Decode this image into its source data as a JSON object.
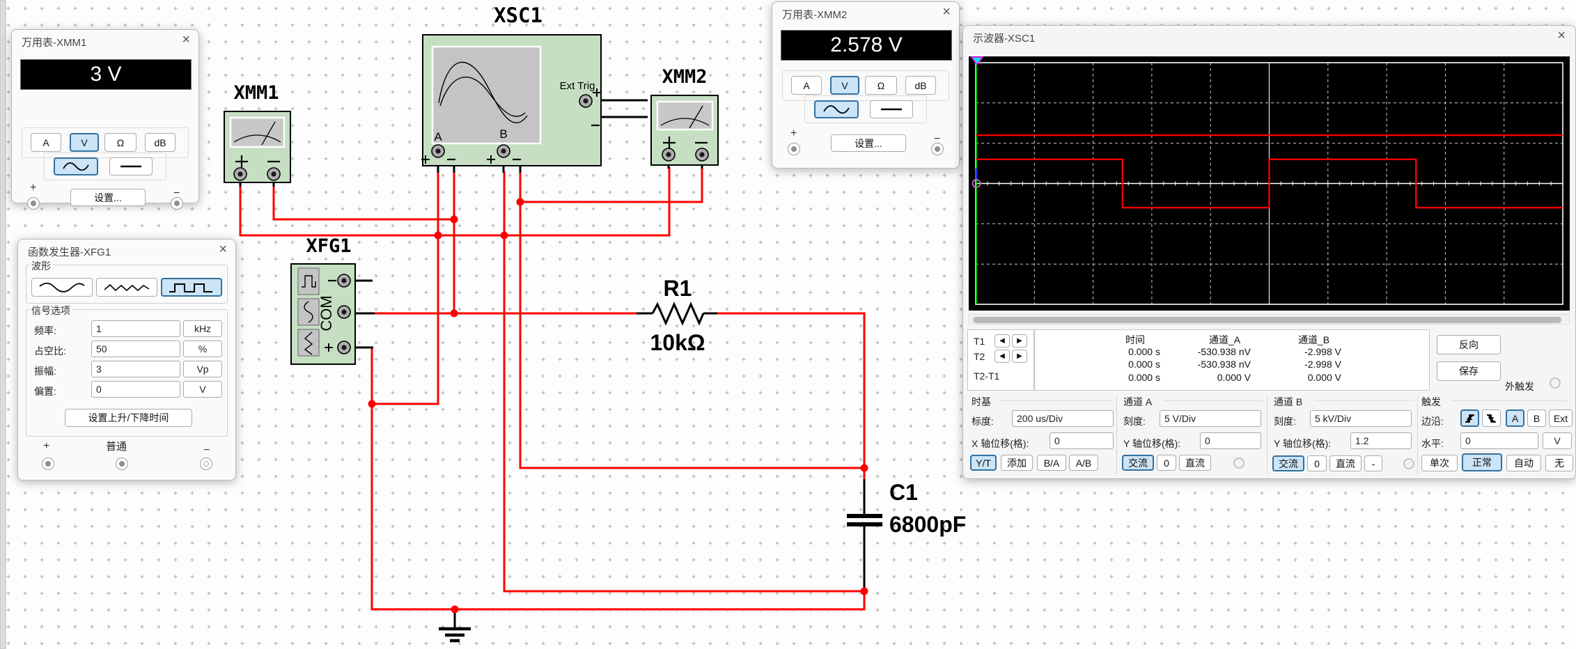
{
  "ui": {
    "close_icon": "×",
    "arrow_left_icon": "◀",
    "arrow_right_icon": "▶"
  },
  "xmm1": {
    "title": "万用表-XMM1",
    "display": "3 V",
    "modes": [
      "A",
      "V",
      "Ω",
      "dB"
    ],
    "selected_mode": "V",
    "ac_icon": "sine-wave",
    "dc_icon": "flat-line",
    "selected_coupling": "AC",
    "settings": "设置...",
    "plus": "+",
    "minus": "−"
  },
  "xmm2": {
    "title": "万用表-XMM2",
    "display": "2.578 V",
    "modes": [
      "A",
      "V",
      "Ω",
      "dB"
    ],
    "selected_mode": "V",
    "ac_icon": "sine-wave",
    "dc_icon": "flat-line",
    "selected_coupling": "AC",
    "settings": "设置...",
    "plus": "+",
    "minus": "−"
  },
  "xfg1": {
    "title": "函数发生器-XFG1",
    "waveform_group": "波形",
    "waveform_icons": [
      "sine-wave",
      "triangle-wave",
      "square-wave"
    ],
    "selected_waveform": "square-wave",
    "signal_group": "信号选项",
    "fields": [
      {
        "label": "频率:",
        "value": "1",
        "unit": "kHz"
      },
      {
        "label": "占空比:",
        "value": "50",
        "unit": "%"
      },
      {
        "label": "振幅:",
        "value": "3",
        "unit": "Vp"
      },
      {
        "label": "偏置:",
        "value": "0",
        "unit": "V"
      }
    ],
    "rise_fall_button": "设置上升/下降时间",
    "plus": "+",
    "common": "普通",
    "minus": "−"
  },
  "scope": {
    "title": "示波器-XSC1",
    "cursors": {
      "t1": "T1",
      "t2": "T2",
      "t2t1": "T2-T1"
    },
    "readout": {
      "headers": [
        "时间",
        "通道_A",
        "通道_B"
      ],
      "rows": [
        [
          "0.000 s",
          "-530.938 nV",
          "-2.998 V"
        ],
        [
          "0.000 s",
          "-530.938 nV",
          "-2.998 V"
        ],
        [
          "0.000 s",
          "0.000 V",
          "0.000 V"
        ]
      ]
    },
    "reverse_button": "反向",
    "save_button": "保存",
    "ext_trigger_label": "外触发",
    "timebase": {
      "group": "时基",
      "scale_label": "标度:",
      "scale_value": "200 us/Div",
      "xpos_label": "X 轴位移(格):",
      "xpos_value": "0",
      "modes": [
        "Y/T",
        "添加",
        "B/A",
        "A/B"
      ],
      "selected": "Y/T"
    },
    "channel_a": {
      "group": "通道 A",
      "scale_label": "刻度:",
      "scale_value": "5  V/Div",
      "ypos_label": "Y 轴位移(格):",
      "ypos_value": "0",
      "coupling": [
        "交流",
        "0",
        "直流"
      ],
      "selected": "交流"
    },
    "channel_b": {
      "group": "通道 B",
      "scale_label": "刻度:",
      "scale_value": "5 kV/Div",
      "ypos_label": "Y 轴位移(格):",
      "ypos_value": "1.2",
      "coupling": [
        "交流",
        "0",
        "直流",
        "-"
      ],
      "selected": "交流"
    },
    "trigger": {
      "group": "触发",
      "edge_label": "边沿:",
      "edge_icons": [
        "rising-edge",
        "falling-edge"
      ],
      "selected_edge": "rising-edge",
      "sources": [
        "A",
        "B",
        "Ext"
      ],
      "selected_source": "A",
      "level_label": "水平:",
      "level_value": "0",
      "level_unit": "V",
      "modes": [
        "单次",
        "正常",
        "自动",
        "无"
      ],
      "selected_mode": "正常"
    }
  },
  "schematic": {
    "xsc1_label": "XSC1",
    "ext_trig": "Ext Trig",
    "ch_a": "A",
    "ch_b": "B",
    "xmm1_label": "XMM1",
    "xmm2_label": "XMM2",
    "xfg1_label": "XFG1",
    "com": "COM",
    "r1_ref": "R1",
    "r1_value": "10kΩ",
    "c1_ref": "C1",
    "c1_value": "6800pF",
    "wire_color": "#FF0000",
    "component_fill": "#C6DFC3"
  },
  "chart_data": {
    "type": "line",
    "title": "示波器-XSC1",
    "x_unit": "us",
    "timebase_us_per_div": 200,
    "divs_x": 10,
    "divs_y": 6,
    "background": "#000000",
    "axis_color": "#FFFFFF",
    "grid": "dashed",
    "series": [
      {
        "name": "通道_A",
        "color": "#FF0000",
        "v_per_div": 5,
        "y_offset_div": 0,
        "t_us": [
          0,
          500,
          500,
          1000,
          1000,
          1500,
          1500,
          2000
        ],
        "v": [
          3,
          3,
          -3,
          -3,
          3,
          3,
          -3,
          -3
        ]
      },
      {
        "name": "通道_B",
        "color": "#FF0000",
        "v_per_div": 5000,
        "y_offset_div": 1.2,
        "t_us": [
          0,
          2000
        ],
        "v": [
          -2.998,
          -2.998
        ]
      }
    ]
  }
}
